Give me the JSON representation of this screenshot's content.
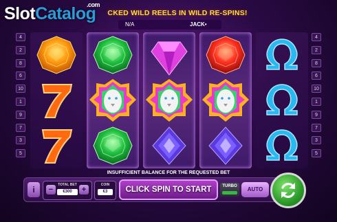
{
  "watermark": {
    "part1": "Slot",
    "part2": "Catalog",
    "suffix": ".com"
  },
  "header": {
    "banner": "CKED WILD REELS IN WILD RE-SPINS!",
    "jackpot_value": "N/A",
    "jackpot_label": "JACK•"
  },
  "paylines": {
    "left": [
      "4",
      "2",
      "8",
      "6",
      "10",
      "1",
      "9",
      "7",
      "3",
      "5"
    ],
    "right": [
      "4",
      "2",
      "8",
      "6",
      "10",
      "1",
      "9",
      "7",
      "3",
      "5"
    ]
  },
  "reels": [
    {
      "type": "normal",
      "symbols": [
        "orange-gem-icon",
        "seven-icon",
        "seven-icon"
      ]
    },
    {
      "type": "wild",
      "symbols": [
        "green-gem-icon",
        "lion-wild-icon",
        "green-gem-icon"
      ]
    },
    {
      "type": "wild",
      "symbols": [
        "pink-gem-icon",
        "lion-wild-icon",
        "purple-gem-icon"
      ]
    },
    {
      "type": "wild",
      "symbols": [
        "red-gem-icon",
        "lion-wild-icon",
        "purple-gem-icon"
      ]
    },
    {
      "type": "normal",
      "symbols": [
        "omega-icon",
        "omega-icon",
        "omega-icon"
      ]
    }
  ],
  "message": "INSUFFICIENT BALANCE FOR THE REQUESTED BET",
  "controls": {
    "info_label": "i",
    "total_bet_label": "TOTAL BET",
    "total_bet_value": "€300",
    "coin_label": "COIN",
    "coin_value": "€3",
    "minus": "−",
    "plus": "+",
    "spin_label": "CLICK SPIN TO START",
    "turbo_label": "TURBO",
    "auto_label": "AUTO"
  },
  "colors": {
    "accent": "#ffd84a",
    "wild_reel": "#5a2a7c",
    "spin_green": "#2c9a2a"
  }
}
